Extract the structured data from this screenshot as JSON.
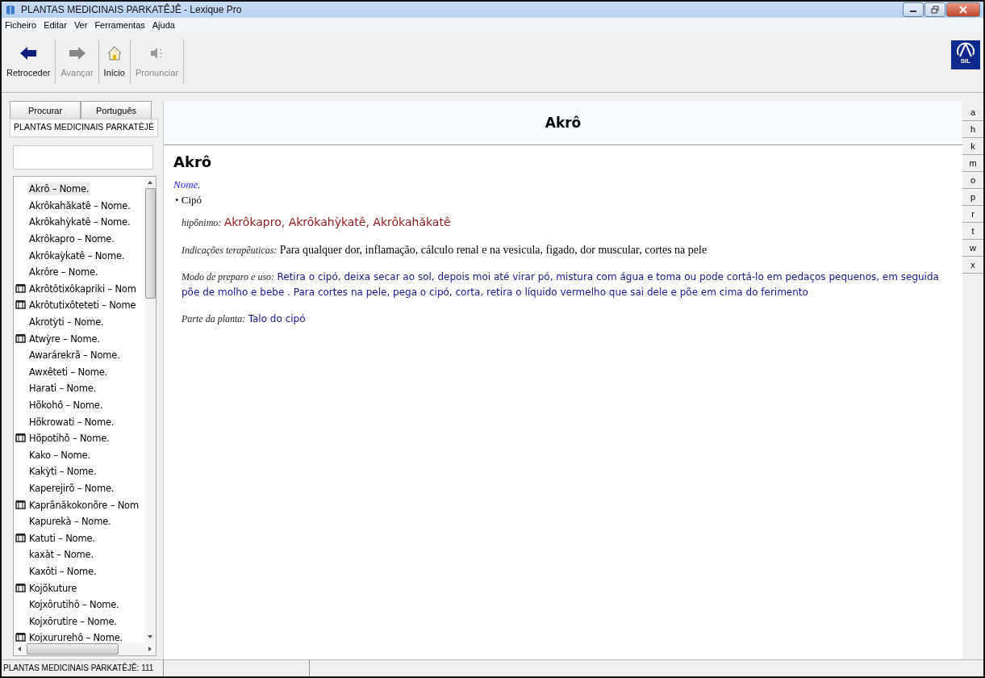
{
  "window": {
    "title": "PLANTAS MEDICINAIS PARKATÊJÊ - Lexique Pro"
  },
  "menu": [
    "Ficheiro",
    "Editar",
    "Ver",
    "Ferramentas",
    "Ajuda"
  ],
  "toolbar": [
    {
      "label": "Retroceder",
      "kind": "back",
      "disabled": false
    },
    {
      "label": "Avançar",
      "kind": "forward",
      "disabled": true
    },
    {
      "label": "Início",
      "kind": "home",
      "disabled": false
    },
    {
      "label": "Pronunciar",
      "kind": "speaker",
      "disabled": true
    }
  ],
  "logo": {
    "text": "SIL"
  },
  "sidebar": {
    "tabs": [
      {
        "label": "Procurar",
        "selected": false
      },
      {
        "label": "Português",
        "selected": false
      }
    ],
    "title": "PLANTAS MEDICINAIS PARKATÊJÊ",
    "items": [
      {
        "label": "Akrô – Nome.",
        "kind": "plain",
        "selected": true
      },
      {
        "label": "Akrôkahăkatê – Nome.",
        "kind": "plain",
        "selected": false
      },
      {
        "label": "Akrôkahỳkatê – Nome.",
        "kind": "plain",
        "selected": false
      },
      {
        "label": "Akrôkapro – Nome.",
        "kind": "plain",
        "selected": false
      },
      {
        "label": "Akrôkaỳkatê – Nome.",
        "kind": "plain",
        "selected": false
      },
      {
        "label": "Akrôre – Nome.",
        "kind": "plain",
        "selected": false
      },
      {
        "label": "Akrôtôtixôkapriki – Nom",
        "kind": "media",
        "selected": false
      },
      {
        "label": "Akrôtutixôteteti – Nome",
        "kind": "media",
        "selected": false
      },
      {
        "label": "Akrotỳti – Nome.",
        "kind": "plain",
        "selected": false
      },
      {
        "label": "Atwỳre – Nome.",
        "kind": "media",
        "selected": false
      },
      {
        "label": "Awarárekrã – Nome.",
        "kind": "plain",
        "selected": false
      },
      {
        "label": "Awxêteti – Nome.",
        "kind": "plain",
        "selected": false
      },
      {
        "label": "Harati – Nome.",
        "kind": "plain",
        "selected": false
      },
      {
        "label": "Hõkohô – Nome.",
        "kind": "plain",
        "selected": false
      },
      {
        "label": "Hõkrowati – Nome.",
        "kind": "plain",
        "selected": false
      },
      {
        "label": "Hõpotihô – Nome.",
        "kind": "media",
        "selected": false
      },
      {
        "label": "Kako – Nome.",
        "kind": "plain",
        "selected": false
      },
      {
        "label": "Kakỳti – Nome.",
        "kind": "plain",
        "selected": false
      },
      {
        "label": "Kaperejirõ – Nome.",
        "kind": "plain",
        "selected": false
      },
      {
        "label": "Kaprãnăkokonõre – Nom",
        "kind": "media",
        "selected": false
      },
      {
        "label": "Kapurekà – Nome.",
        "kind": "plain",
        "selected": false
      },
      {
        "label": "Katuti – Nome.",
        "kind": "media",
        "selected": false
      },
      {
        "label": "kaxàt – Nome.",
        "kind": "plain",
        "selected": false
      },
      {
        "label": "Kaxôti – Nome.",
        "kind": "plain",
        "selected": false
      },
      {
        "label": "Kojõkuture",
        "kind": "media",
        "selected": false
      },
      {
        "label": "Kojxôrutihô – Nome.",
        "kind": "plain",
        "selected": false
      },
      {
        "label": "Kojxôrutire – Nome.",
        "kind": "plain",
        "selected": false
      },
      {
        "label": "Kojxururehô – Nome.",
        "kind": "media",
        "selected": false
      }
    ]
  },
  "entry": {
    "header": "Akrô",
    "headword": "Akrô",
    "pos": "Nome.",
    "sense": "• Cipó",
    "fields": [
      {
        "label": "hipônimo:",
        "value": "Akrôkapro, Akrôkahỳkatê, Akrôkahăkatê",
        "kind": "link"
      },
      {
        "label": "Indicações terapêuticas:",
        "value": "Para qualquer dor, inflamação, cálculo renal e na vesicula, figado, dor muscular, cortes na pele",
        "kind": "plain"
      },
      {
        "label": "Modo de preparo e uso:",
        "value": "Retira o cipó, deixa secar ao sol, depois moi até virar pó, mistura com água e toma ou pode cortá-lo em pedaços pequenos, em seguida põe de molho e bebe . Para cortes na pele, pega o cipó, corta, retira o líquido vermelho que sai dele e põe em cima do ferimento",
        "kind": "note"
      },
      {
        "label": "Parte da planta:",
        "value": "Talo do cipó",
        "kind": "note"
      }
    ]
  },
  "alphabet": [
    "a",
    "h",
    "k",
    "m",
    "o",
    "p",
    "r",
    "t",
    "w",
    "x"
  ],
  "status_bar": {
    "text": "PLANTAS MEDICINAIS PARKATÊJÊ: 111"
  }
}
